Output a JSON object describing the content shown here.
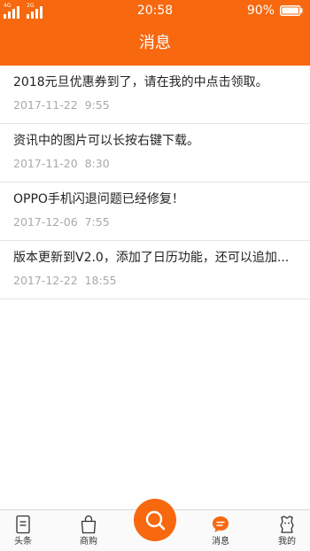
{
  "status_bar": {
    "network_1": "4G",
    "network_2": "2G",
    "time": "20:58",
    "battery": "90%"
  },
  "header": {
    "title": "消息"
  },
  "messages": [
    {
      "title": "2018元旦优惠券到了，请在我的中点击领取。",
      "time": "2017-11-22  9:55"
    },
    {
      "title": "资讯中的图片可以长按右键下载。",
      "time": "2017-11-20  8:30"
    },
    {
      "title": "OPPO手机闪退问题已经修复！",
      "time": "2017-12-06  7:55"
    },
    {
      "title": "版本更新到V2.0，添加了日历功能，还可以追加...",
      "time": "2017-12-22  18:55"
    }
  ],
  "tabbar": {
    "tabs": [
      {
        "label": "头条",
        "icon": "news-icon"
      },
      {
        "label": "商购",
        "icon": "shopping-bag-icon"
      },
      {
        "label": "",
        "icon": "search-icon"
      },
      {
        "label": "消息",
        "icon": "chat-icon"
      },
      {
        "label": "我的",
        "icon": "profile-icon"
      }
    ],
    "active_index": 3
  },
  "colors": {
    "brand": "#f7680f",
    "text_primary": "#222222",
    "text_secondary": "#a9a9a9",
    "divider": "#e4e4e4"
  }
}
